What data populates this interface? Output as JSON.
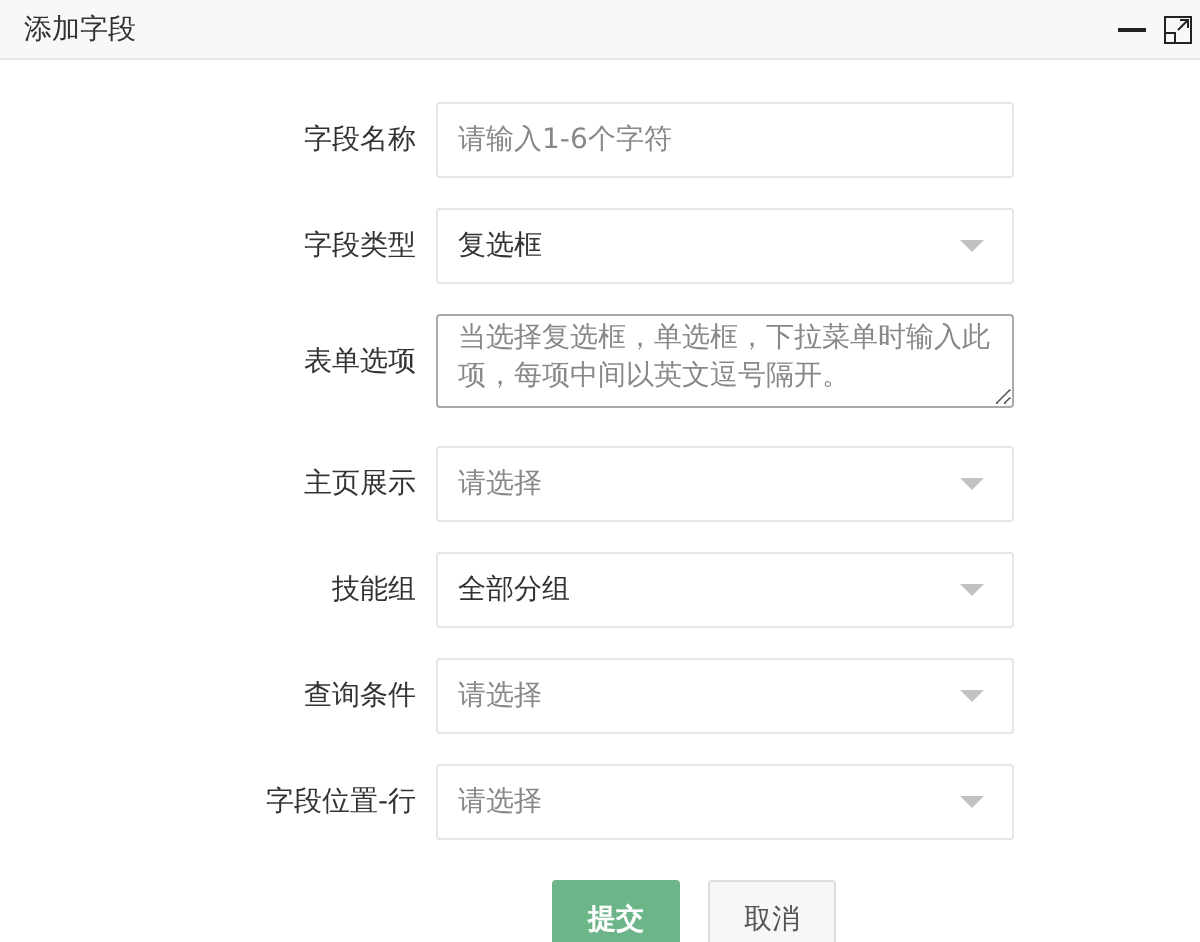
{
  "window": {
    "title": "添加字段"
  },
  "fields": [
    {
      "label": "字段名称",
      "kind": "text",
      "placeholder": "请输入1-6个字符"
    },
    {
      "label": "字段类型",
      "kind": "select",
      "value": "复选框"
    },
    {
      "label": "表单选项",
      "kind": "textarea",
      "placeholder": "当选择复选框，单选框，下拉菜单时输入此项，每项中间以英文逗号隔开。"
    },
    {
      "label": "主页展示",
      "kind": "select",
      "placeholder": "请选择"
    },
    {
      "label": "技能组",
      "kind": "select",
      "value": "全部分组"
    },
    {
      "label": "查询条件",
      "kind": "select",
      "placeholder": "请选择"
    },
    {
      "label": "字段位置-行",
      "kind": "select",
      "placeholder": "请选择"
    }
  ],
  "buttons": [
    {
      "label": "提交",
      "kind": "primary"
    },
    {
      "label": "取消",
      "kind": "default"
    }
  ]
}
